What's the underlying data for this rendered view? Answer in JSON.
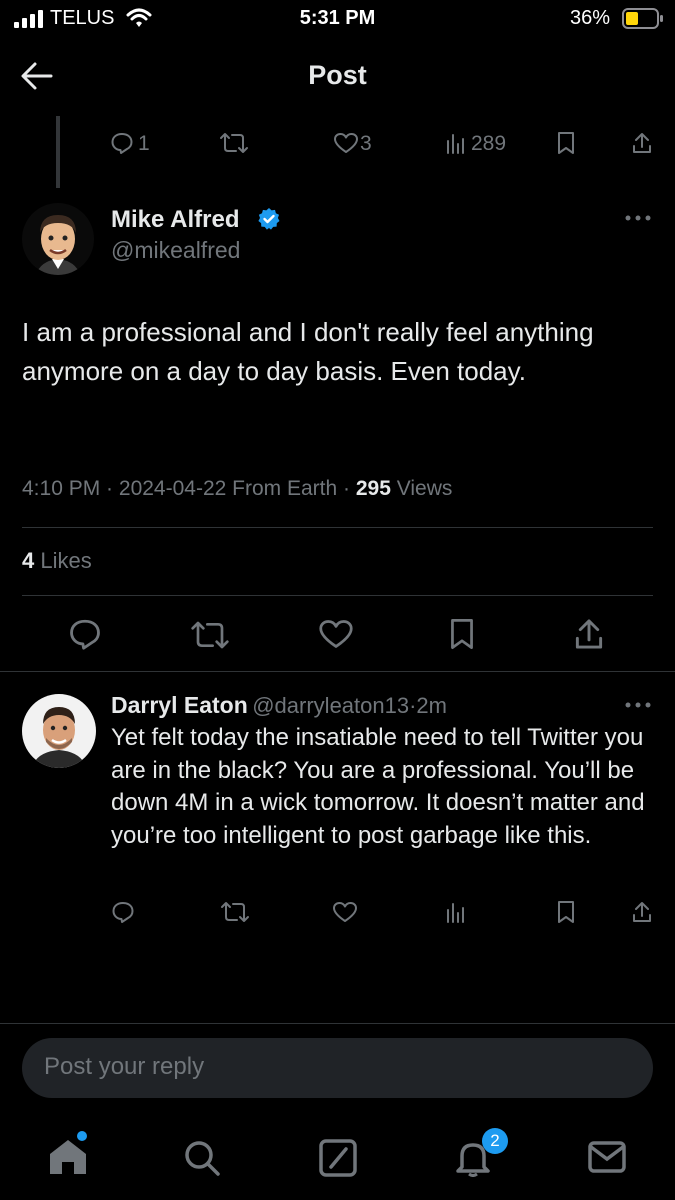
{
  "status_bar": {
    "carrier": "TELUS",
    "time": "5:31 PM",
    "battery": "36%"
  },
  "header": {
    "title": "Post"
  },
  "parent_actions": {
    "replies": "1",
    "likes": "3",
    "views": "289"
  },
  "tweet": {
    "author_name": "Mike Alfred",
    "author_handle": "@mikealfred",
    "text": "I am a professional and I don't really feel anything anymore on a day to day basis. Even today.",
    "time": "4:10 PM",
    "date": "2024-04-22",
    "source": "From Earth",
    "views_count": "295",
    "views_label": "Views",
    "likes_count": "4",
    "likes_label": "Likes"
  },
  "reply": {
    "author_name": "Darryl Eaton",
    "author_handle": "@darryleaton13",
    "time_ago": "2m",
    "text": "Yet felt today the insatiable need to tell Twitter you are in the black? You are a professional. You’ll be down 4M in a wick tomorrow. It doesn’t matter and you’re too intelligent to post garbage like this."
  },
  "composer": {
    "placeholder": "Post your reply"
  },
  "bottom_nav": {
    "notifications_badge": "2"
  },
  "colors": {
    "background": "#000000",
    "text_primary": "#e7e9ea",
    "text_secondary": "#71767b",
    "accent": "#1d9bf0",
    "divider": "#2f3336",
    "battery_fill": "#ffd60a"
  }
}
